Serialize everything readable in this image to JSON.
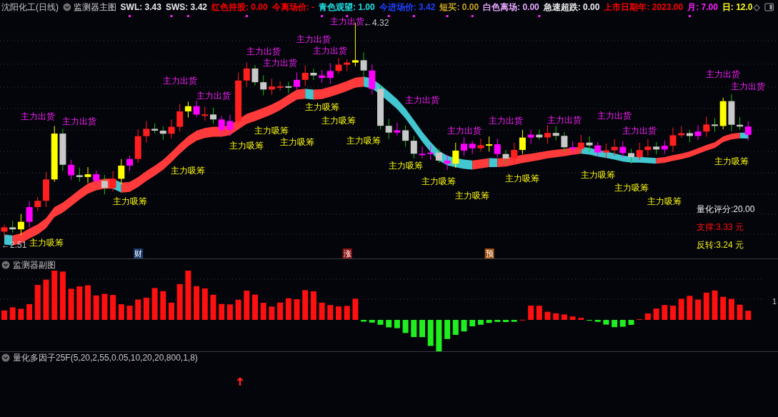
{
  "header": {
    "title": "沈阳化工(日线)",
    "indicator": "监测器主图",
    "readouts": [
      {
        "label": "SWL:",
        "value": "3.43",
        "color": "#e8e8e8"
      },
      {
        "label": "SWS:",
        "value": "3.42",
        "color": "#e8e8e8"
      },
      {
        "label": "红色持股:",
        "value": "0.00",
        "color": "#ff0000"
      },
      {
        "label": "今离场价:",
        "value": "-",
        "color": "#ff0000"
      },
      {
        "label": "青色观望:",
        "value": "1.00",
        "color": "#20e0e0"
      },
      {
        "label": "今进场价:",
        "value": "3.42",
        "color": "#2040ff"
      },
      {
        "label": "短买:",
        "value": "0.00",
        "color": "#c8a820"
      },
      {
        "label": "白色离场:",
        "value": "0.00",
        "color": "#e8a8ff"
      },
      {
        "label": "急速超跌:",
        "value": "0.00",
        "color": "#f0f0f0"
      },
      {
        "label": "上市日期年:",
        "value": "2023.00",
        "color": "#ff0000"
      },
      {
        "label": "月:",
        "value": "7.00",
        "color": "#ff20ff"
      },
      {
        "label": "日:",
        "value": "12.0",
        "color": "#ffff20"
      }
    ],
    "end_mark": "◇"
  },
  "main_chart": {
    "high_label": "←4.32",
    "low_label": "←2.51",
    "signals": [
      {
        "kind": "sell",
        "text": "主力出货"
      },
      {
        "kind": "sell",
        "text": "主力出货"
      },
      {
        "kind": "sell",
        "text": "主力出货"
      },
      {
        "kind": "sell",
        "text": "主力出货"
      },
      {
        "kind": "sell",
        "text": "主力出货"
      },
      {
        "kind": "sell",
        "text": "主力出货"
      },
      {
        "kind": "sell",
        "text": "主力出货"
      },
      {
        "kind": "sell",
        "text": "主力出货"
      },
      {
        "kind": "sell",
        "text": "主力出货"
      },
      {
        "kind": "sell",
        "text": "主力出货"
      },
      {
        "kind": "sell",
        "text": "主力出货"
      },
      {
        "kind": "sell",
        "text": "主力出货"
      },
      {
        "kind": "sell",
        "text": "主力出货"
      },
      {
        "kind": "sell",
        "text": "主力出货"
      },
      {
        "kind": "sell",
        "text": "主力出货"
      },
      {
        "kind": "sell",
        "text": "主力出货"
      },
      {
        "kind": "sell",
        "text": "主力出货"
      },
      {
        "kind": "buy",
        "text": "主力吸筹"
      },
      {
        "kind": "buy",
        "text": "主力吸筹"
      },
      {
        "kind": "buy",
        "text": "主力吸筹"
      },
      {
        "kind": "buy",
        "text": "主力吸筹"
      },
      {
        "kind": "buy",
        "text": "主力吸筹"
      },
      {
        "kind": "buy",
        "text": "主力吸筹"
      },
      {
        "kind": "buy",
        "text": "主力吸筹"
      },
      {
        "kind": "buy",
        "text": "主力吸筹"
      },
      {
        "kind": "buy",
        "text": "主力吸筹"
      },
      {
        "kind": "buy",
        "text": "主力吸筹"
      },
      {
        "kind": "buy",
        "text": "主力吸筹"
      },
      {
        "kind": "buy",
        "text": "主力吸筹"
      },
      {
        "kind": "buy",
        "text": "主力吸筹"
      },
      {
        "kind": "buy",
        "text": "主力吸筹"
      },
      {
        "kind": "buy",
        "text": "主力吸筹"
      },
      {
        "kind": "buy",
        "text": "主力吸筹"
      },
      {
        "kind": "buy",
        "text": "主力吸筹"
      }
    ],
    "events": [
      {
        "text": "财",
        "color": "#1c3c6c"
      },
      {
        "text": "涨",
        "color": "#8c1414"
      },
      {
        "text": "预",
        "color": "#a0500c"
      }
    ],
    "scores": [
      {
        "text": "量化评分:20.00",
        "color": "#f0f0f0"
      },
      {
        "text": "支撑:3.33 元",
        "color": "#ff1010"
      },
      {
        "text": "反转:3.24 元",
        "color": "#f0f020"
      }
    ]
  },
  "sub_panel": {
    "title": "监测器副图",
    "axis_label": "1"
  },
  "factor_panel": {
    "title": "量化多因子25F(5,20,2,55,0.05,10,20,20,800,1,8)"
  }
}
